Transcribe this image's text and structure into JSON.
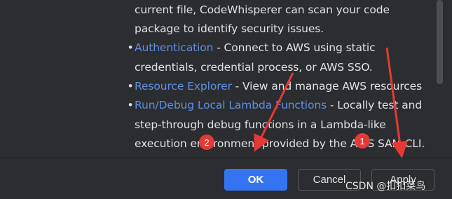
{
  "content": {
    "intro_lines": [
      "current file, CodeWhisperer can scan your code",
      "package to identify security issues."
    ],
    "bullets": [
      {
        "link": "Authentication",
        "lines": [
          " - Connect to AWS using static",
          "credentials, credential process, or AWS SSO."
        ]
      },
      {
        "link": "Resource Explorer",
        "lines": [
          " - View and manage AWS resources"
        ]
      },
      {
        "link": "Run/Debug Local Lambda Functions",
        "lines": [
          " - Locally test and",
          "step-through debug functions in a Lambda-like",
          "execution environment provided by the AWS SAM CLI."
        ]
      }
    ]
  },
  "buttons": {
    "ok": "OK",
    "cancel": "Cancel",
    "apply": "Apply"
  },
  "annotations": {
    "badge_1": "1",
    "badge_2": "2",
    "color": "#e53935"
  },
  "watermark": "CSDN @扣扣菜鸟",
  "colors": {
    "background": "#2b2d30",
    "text": "#dfe1e5",
    "link": "#5f8fe3",
    "primary_button": "#3574f0"
  }
}
